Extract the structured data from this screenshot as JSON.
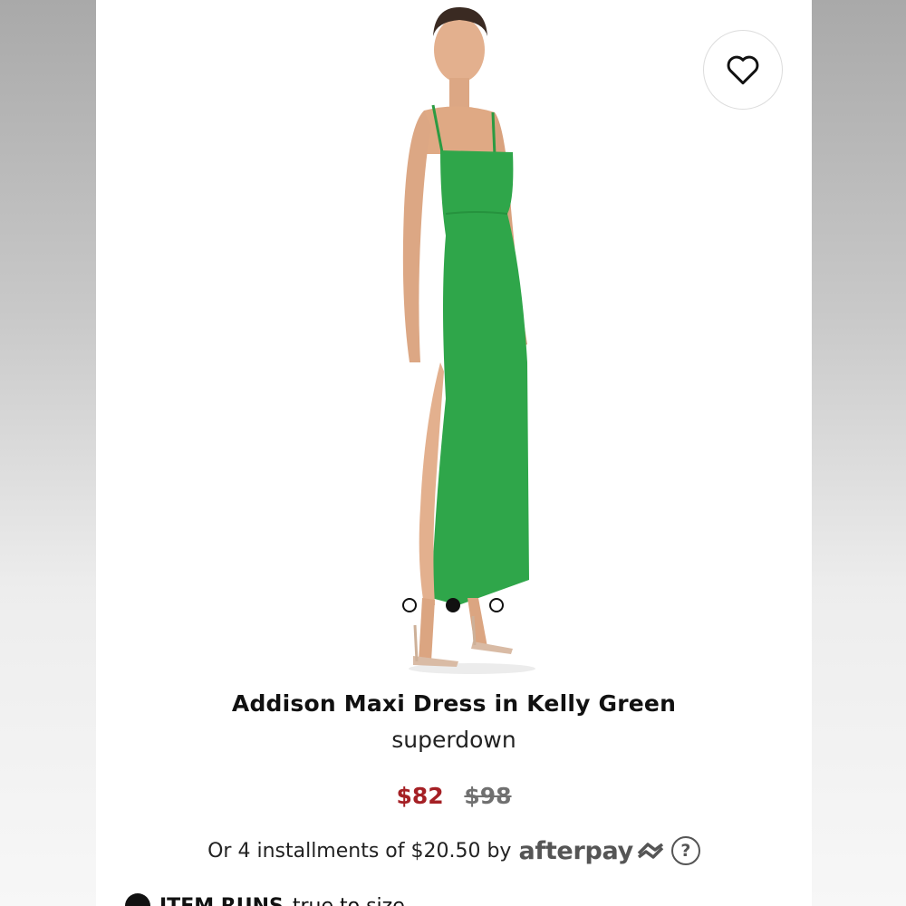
{
  "product": {
    "name": "Addison Maxi Dress in Kelly Green",
    "brand": "superdown",
    "sale_price": "$82",
    "original_price": "$98",
    "dress_color": "#2fa64a"
  },
  "gallery": {
    "slide_count": 3,
    "active_slide": 2
  },
  "favorite": {
    "icon": "heart-outline-icon"
  },
  "payment": {
    "installments_text": "Or 4 installments of $20.50 by",
    "provider_logo_text": "afterpay",
    "help_glyph": "?"
  },
  "footer_partial": {
    "label": "ITEM RUNS",
    "rest": "true to size"
  },
  "colors": {
    "sale": "#a52025",
    "original": "#707070",
    "text": "#111111"
  }
}
